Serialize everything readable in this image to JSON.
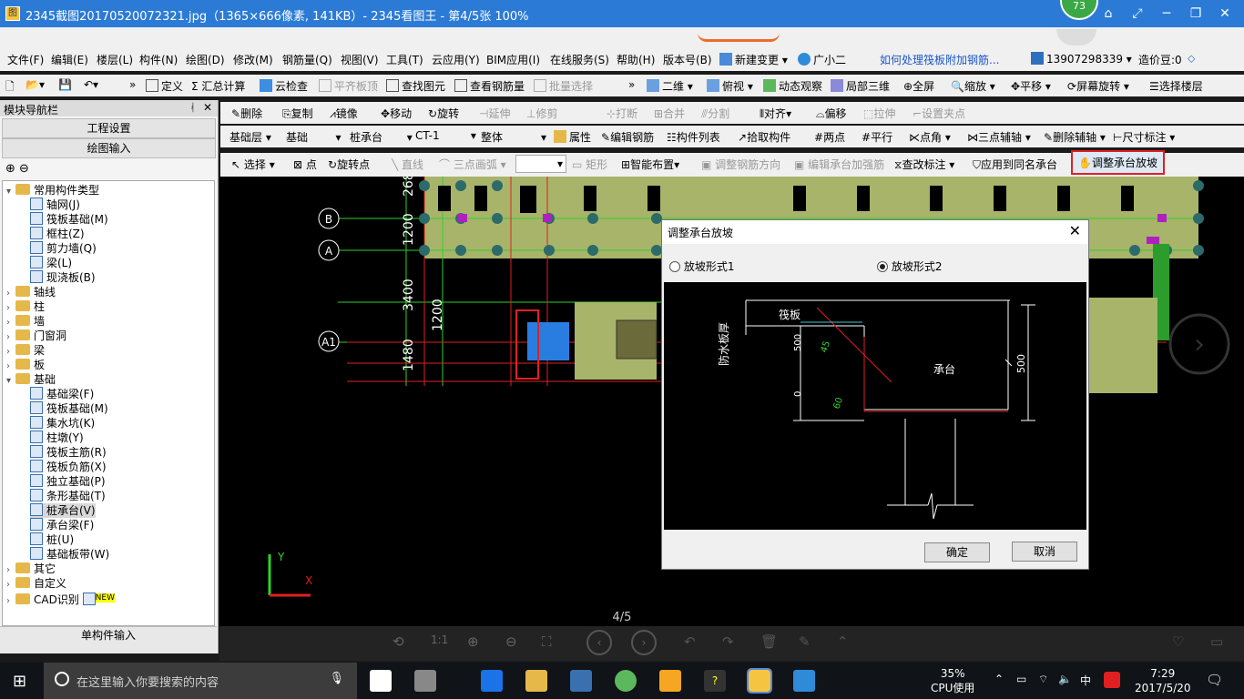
{
  "titlebar": {
    "title": "2345截图20170520072321.jpg（1365×666像素, 141KB）- 2345看图王 - 第4/5张 100%",
    "badge": "73"
  },
  "menubar": {
    "items": [
      "文件(F)",
      "编辑(E)",
      "楼层(L)",
      "构件(N)",
      "绘图(D)",
      "修改(M)",
      "钢筋量(Q)",
      "视图(V)",
      "工具(T)",
      "云应用(Y)",
      "BIM应用(I)",
      "在线服务(S)",
      "帮助(H)",
      "版本号(B)",
      "新建变更",
      "广小二",
      "如何处理筏板附加钢筋...",
      "13907298339",
      "造价豆:0"
    ]
  },
  "toolbar1": {
    "items": [
      "定义",
      "汇总计算",
      "云检查",
      "平齐板顶",
      "查找图元",
      "查看钢筋量",
      "批量选择",
      "二维",
      "俯视",
      "动态观察",
      "局部三维",
      "全屏",
      "缩放",
      "平移",
      "屏幕旋转",
      "选择楼层"
    ]
  },
  "toolbar2": {
    "items": [
      "删除",
      "复制",
      "镜像",
      "移动",
      "旋转",
      "延伸",
      "修剪",
      "打断",
      "合并",
      "分割",
      "对齐",
      "偏移",
      "拉伸",
      "设置夹点"
    ]
  },
  "toolbar3": {
    "items": [
      "基础层",
      "基础",
      "桩承台",
      "CT-1",
      "整体",
      "属性",
      "编辑钢筋",
      "构件列表",
      "拾取构件",
      "两点",
      "平行",
      "点角",
      "三点辅轴",
      "删除辅轴",
      "尺寸标注"
    ]
  },
  "toolbar4": {
    "items": [
      "选择",
      "点",
      "旋转点",
      "直线",
      "三点画弧",
      "矩形",
      "智能布置",
      "调整钢筋方向",
      "编辑承台加强筋",
      "查改标注",
      "应用到同名承台",
      "调整承台放坡"
    ]
  },
  "nav": {
    "header": "模块导航栏",
    "btn1": "工程设置",
    "btn2": "绘图输入",
    "bottom": "单构件输入",
    "tree": [
      {
        "label": "常用构件类型",
        "type": "folder",
        "level": 0,
        "expanded": true
      },
      {
        "label": "轴网(J)",
        "type": "leaf",
        "level": 1
      },
      {
        "label": "筏板基础(M)",
        "type": "leaf",
        "level": 1
      },
      {
        "label": "框柱(Z)",
        "type": "leaf",
        "level": 1
      },
      {
        "label": "剪力墙(Q)",
        "type": "leaf",
        "level": 1
      },
      {
        "label": "梁(L)",
        "type": "leaf",
        "level": 1
      },
      {
        "label": "现浇板(B)",
        "type": "leaf",
        "level": 1
      },
      {
        "label": "轴线",
        "type": "folder",
        "level": 0
      },
      {
        "label": "柱",
        "type": "folder",
        "level": 0
      },
      {
        "label": "墙",
        "type": "folder",
        "level": 0
      },
      {
        "label": "门窗洞",
        "type": "folder",
        "level": 0
      },
      {
        "label": "梁",
        "type": "folder",
        "level": 0
      },
      {
        "label": "板",
        "type": "folder",
        "level": 0
      },
      {
        "label": "基础",
        "type": "folder",
        "level": 0,
        "expanded": true
      },
      {
        "label": "基础梁(F)",
        "type": "leaf",
        "level": 1
      },
      {
        "label": "筏板基础(M)",
        "type": "leaf",
        "level": 1
      },
      {
        "label": "集水坑(K)",
        "type": "leaf",
        "level": 1
      },
      {
        "label": "柱墩(Y)",
        "type": "leaf",
        "level": 1
      },
      {
        "label": "筏板主筋(R)",
        "type": "leaf",
        "level": 1
      },
      {
        "label": "筏板负筋(X)",
        "type": "leaf",
        "level": 1
      },
      {
        "label": "独立基础(P)",
        "type": "leaf",
        "level": 1
      },
      {
        "label": "条形基础(T)",
        "type": "leaf",
        "level": 1
      },
      {
        "label": "桩承台(V)",
        "type": "leaf",
        "level": 1,
        "selected": true
      },
      {
        "label": "承台梁(F)",
        "type": "leaf",
        "level": 1
      },
      {
        "label": "桩(U)",
        "type": "leaf",
        "level": 1
      },
      {
        "label": "基础板带(W)",
        "type": "leaf",
        "level": 1
      },
      {
        "label": "其它",
        "type": "folder",
        "level": 0
      },
      {
        "label": "自定义",
        "type": "folder",
        "level": 0
      },
      {
        "label": "CAD识别",
        "type": "folder",
        "level": 0,
        "badge": "NEW"
      }
    ]
  },
  "canvas": {
    "axis_labels": [
      "B",
      "A",
      "A1"
    ],
    "dims": [
      "268",
      "1200",
      "3400",
      "1480",
      "1200"
    ],
    "page_indicator": "4/5",
    "x_label": "X",
    "y_label": "Y"
  },
  "dialog": {
    "title": "调整承台放坡",
    "option1": "放坡形式1",
    "option2": "放坡形式2",
    "selected": 2,
    "diagram": {
      "raft": "筏板",
      "waterproof": "防水板厚",
      "cap": "承台",
      "dim_500_left": "500",
      "dim_0": "0",
      "angle_45": "45",
      "angle_60": "60",
      "dim_500_right": "500"
    },
    "ok": "确定",
    "cancel": "取消"
  },
  "taskbar": {
    "search": "在这里输入你要搜索的内容",
    "cpu": "35%",
    "cpu_label": "CPU使用",
    "ime": "中",
    "time": "7:29",
    "date": "2017/5/20"
  },
  "colors": {
    "titlebar": "#2b7bd6",
    "highlight": "#e02020",
    "cad_green": "#2ed12e",
    "cap_fill": "#a8b46a"
  }
}
